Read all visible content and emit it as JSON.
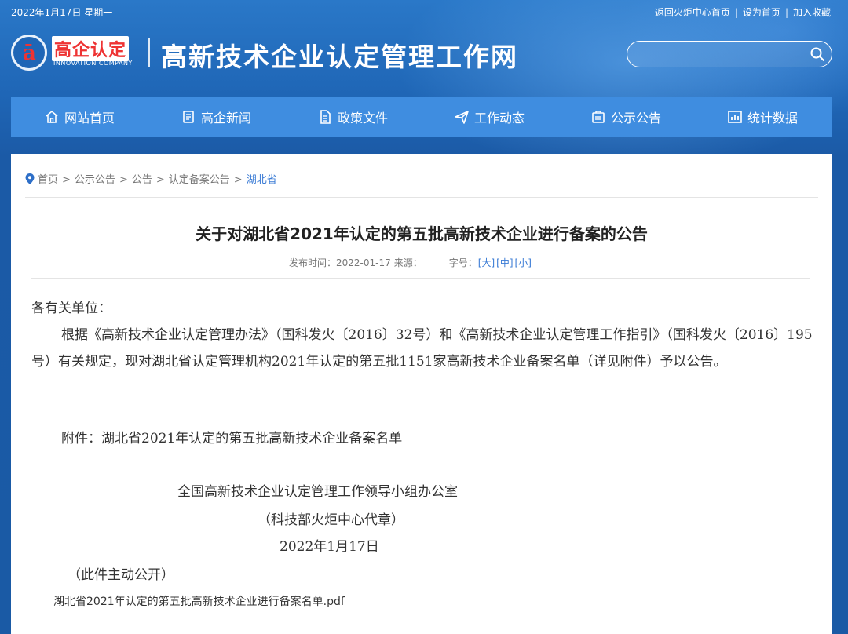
{
  "topbar": {
    "date": "2022年1月17日 星期一",
    "links": [
      "返回火炬中心首页",
      "设为首页",
      "加入收藏"
    ],
    "separator": "|"
  },
  "logo": {
    "mark": "ā",
    "text_cn": "高企认定",
    "text_en": "INNOVATION COMPANY"
  },
  "site_title": "高新技术企业认定管理工作网",
  "search": {
    "placeholder": "",
    "icon": "search-icon"
  },
  "nav": {
    "items": [
      {
        "label": "网站首页",
        "icon": "home-icon"
      },
      {
        "label": "高企新闻",
        "icon": "document-icon"
      },
      {
        "label": "政策文件",
        "icon": "file-icon"
      },
      {
        "label": "工作动态",
        "icon": "send-icon"
      },
      {
        "label": "公示公告",
        "icon": "notice-icon"
      },
      {
        "label": "统计数据",
        "icon": "chart-icon"
      }
    ]
  },
  "breadcrumb": {
    "items": [
      "首页",
      "公示公告",
      "公告",
      "认定备案公告"
    ],
    "current": "湖北省",
    "separator": ">"
  },
  "article": {
    "title": "关于对湖北省2021年认定的第五批高新技术企业进行备案的公告",
    "meta": {
      "publish_label": "发布时间：2022-01-17",
      "source_label": "来源：",
      "size_label": "字号：",
      "size_large": "[大]",
      "size_medium": "[中]",
      "size_small": "[小]"
    },
    "salutation": "各有关单位：",
    "paragraph": "根据《高新技术企业认定管理办法》（国科发火〔2016〕32号）和《高新技术企业认定管理工作指引》（国科发火〔2016〕195号）有关规定，现对湖北省认定管理机构2021年认定的第五批1151家高新技术企业备案名单（详见附件）予以公告。",
    "attachment_line": "附件：湖北省2021年认定的第五批高新技术企业备案名单",
    "signature_org": "全国高新技术企业认定管理工作领导小组办公室",
    "signature_sub": "（科技部火炬中心代章）",
    "signature_date": "2022年1月17日",
    "disclosure_note": "（此件主动公开）",
    "attachment_file": "湖北省2021年认定的第五批高新技术企业进行备案名单.pdf"
  }
}
